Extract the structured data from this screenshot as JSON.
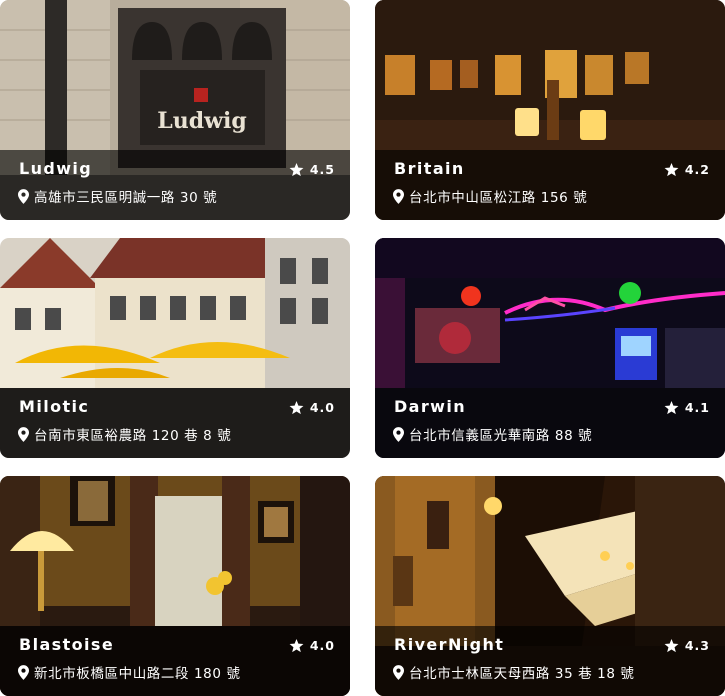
{
  "cards": [
    {
      "name": "Ludwig",
      "rating": "4.5",
      "address": "高雄市三民區明誠一路 30 號",
      "photo": "storefront-photo"
    },
    {
      "name": "Britain",
      "rating": "4.2",
      "address": "台北市中山區松江路 156 號",
      "photo": "pub-interior-photo"
    },
    {
      "name": "Milotic",
      "rating": "4.0",
      "address": "台南市東區裕農路 120 巷 8 號",
      "photo": "umbrellas-street-photo"
    },
    {
      "name": "Darwin",
      "rating": "4.1",
      "address": "台北市信義區光華南路 88 號",
      "photo": "neon-bar-photo"
    },
    {
      "name": "Blastoise",
      "rating": "4.0",
      "address": "新北市板橋區中山路二段 180 號",
      "photo": "vintage-lounge-photo"
    },
    {
      "name": "RiverNight",
      "rating": "4.3",
      "address": "台北市士林區天母西路 35 巷 18 號",
      "photo": "alley-night-photo"
    }
  ]
}
